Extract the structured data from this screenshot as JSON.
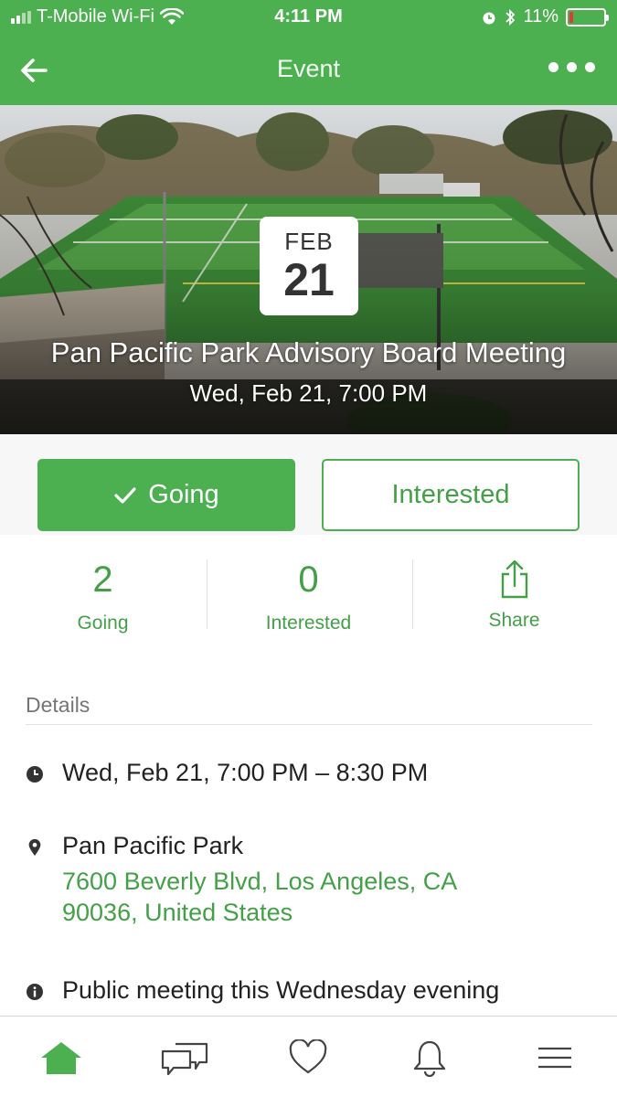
{
  "status_bar": {
    "carrier": "T-Mobile Wi-Fi",
    "time": "4:11 PM",
    "battery": "11%",
    "battery_level": 0.11
  },
  "header": {
    "title": "Event"
  },
  "hero": {
    "month": "FEB",
    "day": "21",
    "title": "Pan Pacific Park Advisory Board Meeting",
    "datetime": "Wed, Feb 21, 7:00 PM"
  },
  "rsvp": {
    "going_label": "Going",
    "interested_label": "Interested"
  },
  "stats": {
    "going_count": "2",
    "going_label": "Going",
    "interested_count": "0",
    "interested_label": "Interested",
    "share_label": "Share"
  },
  "details": {
    "heading": "Details",
    "time_range": "Wed, Feb 21, 7:00 PM – 8:30 PM",
    "location_name": "Pan Pacific Park",
    "address_line1": "7600 Beverly Blvd, Los Angeles, CA",
    "address_line2": "90036, United States",
    "description": "Public meeting this Wednesday evening"
  },
  "bottom_nav": {
    "items": [
      "home-icon",
      "chat-icon",
      "heart-icon",
      "bell-icon",
      "menu-icon"
    ]
  },
  "colors": {
    "brand_green": "#4caf50",
    "link_green": "#43a047",
    "battery_low": "#e53935"
  }
}
